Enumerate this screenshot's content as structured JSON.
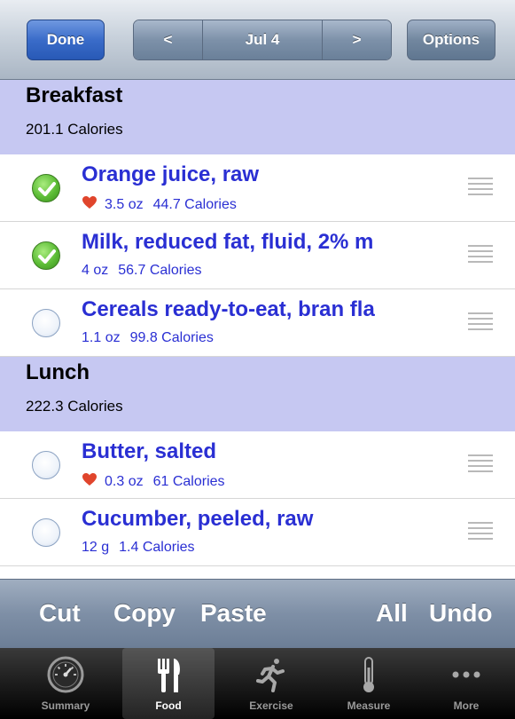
{
  "navbar": {
    "done_label": "Done",
    "prev_label": "<",
    "date_label": "Jul 4",
    "next_label": ">",
    "options_label": "Options"
  },
  "sections": [
    {
      "title": "Breakfast",
      "calories": "201.1 Calories",
      "items": [
        {
          "name": "Orange juice, raw",
          "amount": "3.5 oz",
          "calories": "44.7 Calories",
          "checked": true,
          "favorite": true
        },
        {
          "name": "Milk, reduced fat, fluid, 2% m",
          "amount": "4 oz",
          "calories": "56.7 Calories",
          "checked": true,
          "favorite": false
        },
        {
          "name": "Cereals ready-to-eat, bran fla",
          "amount": "1.1 oz",
          "calories": "99.8 Calories",
          "checked": false,
          "favorite": false
        }
      ]
    },
    {
      "title": "Lunch",
      "calories": "222.3 Calories",
      "items": [
        {
          "name": "Butter, salted",
          "amount": "0.3 oz",
          "calories": "61 Calories",
          "checked": false,
          "favorite": true
        },
        {
          "name": "Cucumber, peeled, raw",
          "amount": "12 g",
          "calories": "1.4 Calories",
          "checked": false,
          "favorite": false
        }
      ]
    }
  ],
  "edit_bar": {
    "cut": "Cut",
    "copy": "Copy",
    "paste": "Paste",
    "all": "All",
    "undo": "Undo"
  },
  "tabs": [
    {
      "label": "Summary",
      "icon": "speedometer-icon",
      "active": false
    },
    {
      "label": "Food",
      "icon": "fork-knife-icon",
      "active": true
    },
    {
      "label": "Exercise",
      "icon": "runner-icon",
      "active": false
    },
    {
      "label": "Measure",
      "icon": "thermometer-icon",
      "active": false
    },
    {
      "label": "More",
      "icon": "more-dots-icon",
      "active": false
    }
  ],
  "colors": {
    "section_bg": "#c6c8f2",
    "food_text": "#2a2fd3",
    "done_button": "#3a6cc9",
    "heart": "#e0452c",
    "check_on": "#5cbc36"
  }
}
